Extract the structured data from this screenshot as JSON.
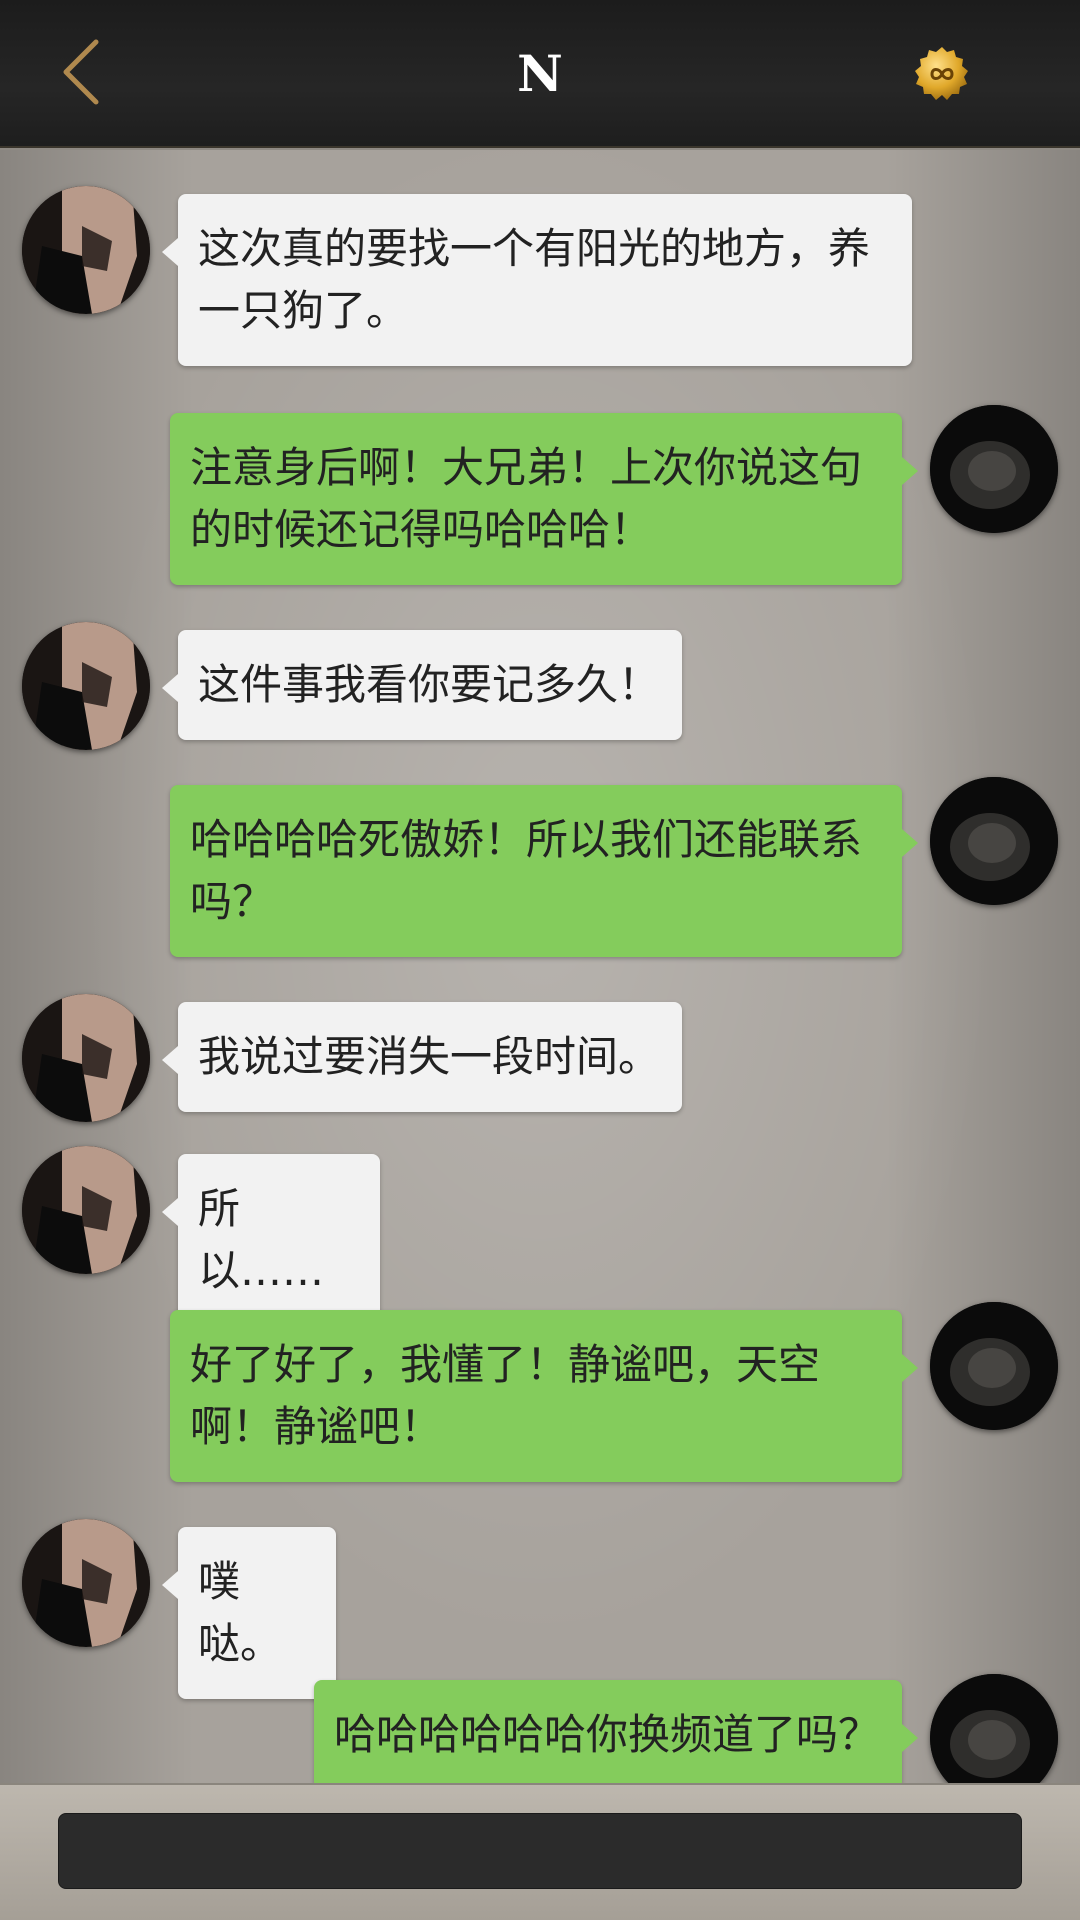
{
  "header": {
    "title": "N",
    "back_icon": "chevron-left-icon",
    "badge_icon": "infinity-badge-icon",
    "accent_color": "#b0894e"
  },
  "messages": [
    {
      "side": "in",
      "text": "这次真的要找一个有阳光的地方，养一只狗了。"
    },
    {
      "side": "out",
      "text": "注意身后啊！大兄弟！上次你说这句的时候还记得吗哈哈哈！"
    },
    {
      "side": "in",
      "text": "这件事我看你要记多久！"
    },
    {
      "side": "out",
      "text": "哈哈哈哈死傲娇！所以我们还能联系吗？"
    },
    {
      "side": "in",
      "text": "我说过要消失一段时间。"
    },
    {
      "side": "in",
      "text": "所以……"
    },
    {
      "side": "out",
      "text": "好了好了，我懂了！静谧吧，天空啊！静谧吧！"
    },
    {
      "side": "in",
      "text": "噗哒。"
    },
    {
      "side": "out",
      "text": "哈哈哈哈哈哈你换频道了吗？"
    }
  ],
  "composer": {
    "value": "",
    "placeholder": ""
  },
  "colors": {
    "incoming_bubble": "#f2f2f2",
    "outgoing_bubble": "#84cc5c",
    "topbar": "#222222"
  }
}
